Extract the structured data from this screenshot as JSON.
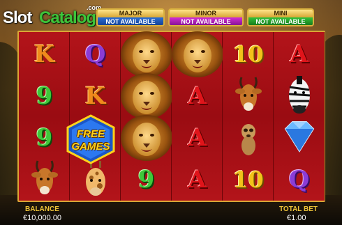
{
  "logo": {
    "slot": "Slot",
    "catalog": "Catalog",
    "com": ".com"
  },
  "jackpots": [
    {
      "title": "MAJOR",
      "value": "NOT AVAILABLE"
    },
    {
      "title": "MINOR",
      "value": "NOT AVAILABLE"
    },
    {
      "title": "MINI",
      "value": "NOT AVAILABLE"
    }
  ],
  "reels": [
    [
      "K",
      "9",
      "9",
      "impala"
    ],
    [
      "Q",
      "K",
      "free-games",
      "giraffe"
    ],
    [
      "lion",
      "lion",
      "lion",
      "9"
    ],
    [
      "lion",
      "A",
      "A",
      "A"
    ],
    [
      "10",
      "impala",
      "meerkat",
      "10"
    ],
    [
      "A",
      "zebra",
      "diamond",
      "Q"
    ]
  ],
  "free_games": {
    "line1": "FREE",
    "line2": "GAMES"
  },
  "footer": {
    "balance_label": "BALANCE",
    "balance_value": "€10,000.00",
    "bet_label": "TOTAL BET",
    "bet_value": "€1.00"
  },
  "colors": {
    "reel_bg": "#9c0d0d",
    "frame": "#d9a736",
    "label": "#f0c53a"
  }
}
